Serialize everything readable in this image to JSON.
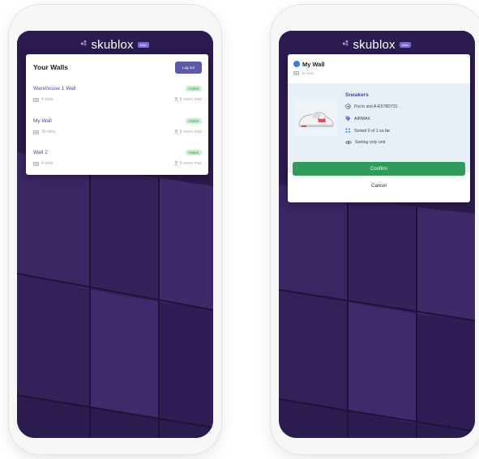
{
  "brand": {
    "name": "skublox",
    "badge": "beta"
  },
  "walls_screen": {
    "title": "Your Walls",
    "logout_label": "Log out",
    "walls": [
      {
        "name": "Warehouse 1 Wall",
        "status": "Active",
        "slots": "4 slots",
        "users": "6 users max"
      },
      {
        "name": "My Wall",
        "status": "Active",
        "slots": "30 slots",
        "users": "6 users max"
      },
      {
        "name": "Wall 2",
        "status": "Active",
        "slots": "4 slots",
        "users": "6 users max"
      }
    ]
  },
  "confirm_screen": {
    "wall_title": "My Wall",
    "wall_slots": "30 slots",
    "item": {
      "name": "Sneakers",
      "slot_text": "Put in slot A-E578D731",
      "tag": "AIRMAX",
      "sorted": "Sorted 0 of 1 so far",
      "sorting_note": "Sorting only unit"
    },
    "confirm_label": "Confirm",
    "cancel_label": "Cancel"
  },
  "colors": {
    "primary": "#5c5aa8",
    "success": "#2f9a59",
    "status_bg": "#c9ecd2",
    "wall_bg": "#2c1b4e",
    "dot": "#3b7fe0"
  }
}
